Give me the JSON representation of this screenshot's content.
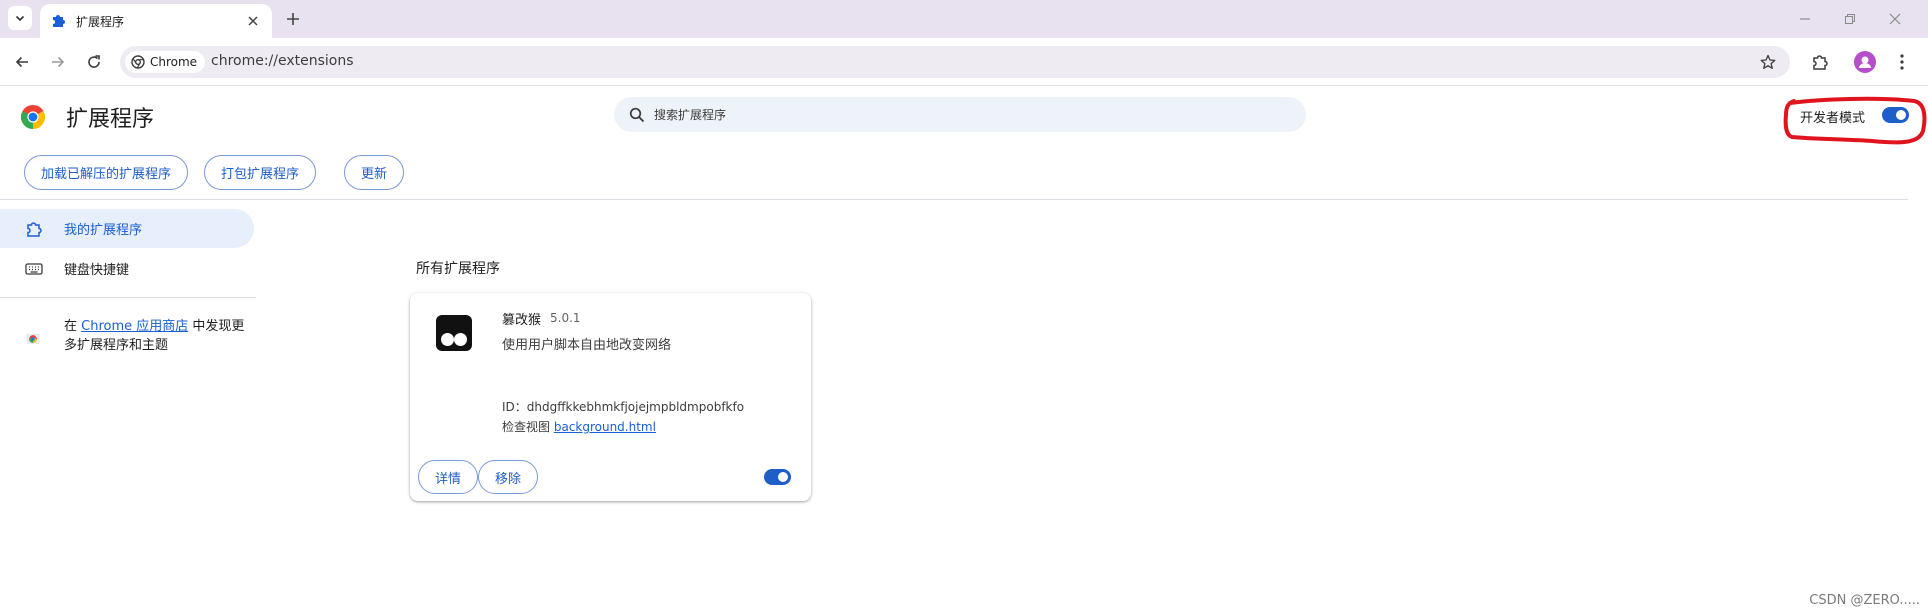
{
  "browser": {
    "tab_title": "扩展程序",
    "chip_label": "Chrome",
    "url": "chrome://extensions"
  },
  "header": {
    "title": "扩展程序",
    "search_placeholder": "搜索扩展程序",
    "dev_mode_label": "开发者模式",
    "dev_mode_enabled": true
  },
  "actions": {
    "load_unpacked": "加载已解压的扩展程序",
    "pack": "打包扩展程序",
    "update": "更新"
  },
  "sidebar": {
    "items": [
      {
        "label": "我的扩展程序",
        "active": true
      },
      {
        "label": "键盘快捷键",
        "active": false
      }
    ],
    "webstore": {
      "prefix": "在 ",
      "link": "Chrome 应用商店",
      "suffix": " 中发现更多扩展程序和主题"
    }
  },
  "main": {
    "section_title": "所有扩展程序",
    "extensions": [
      {
        "name": "篡改猴",
        "version": "5.0.1",
        "description": "使用用户脚本自由地改变网络",
        "id_label": "ID：",
        "id": "dhdgffkkebhmkfjojejmpbldmpobfkfo",
        "views_label": "检查视图 ",
        "views_link": "background.html",
        "details_label": "详情",
        "remove_label": "移除",
        "enabled": true
      }
    ]
  },
  "watermark": "CSDN @ZERO.....",
  "colors": {
    "accent": "#1f5dc9",
    "tab_strip": "#e8e2f0",
    "annotation": "#e0141e"
  }
}
